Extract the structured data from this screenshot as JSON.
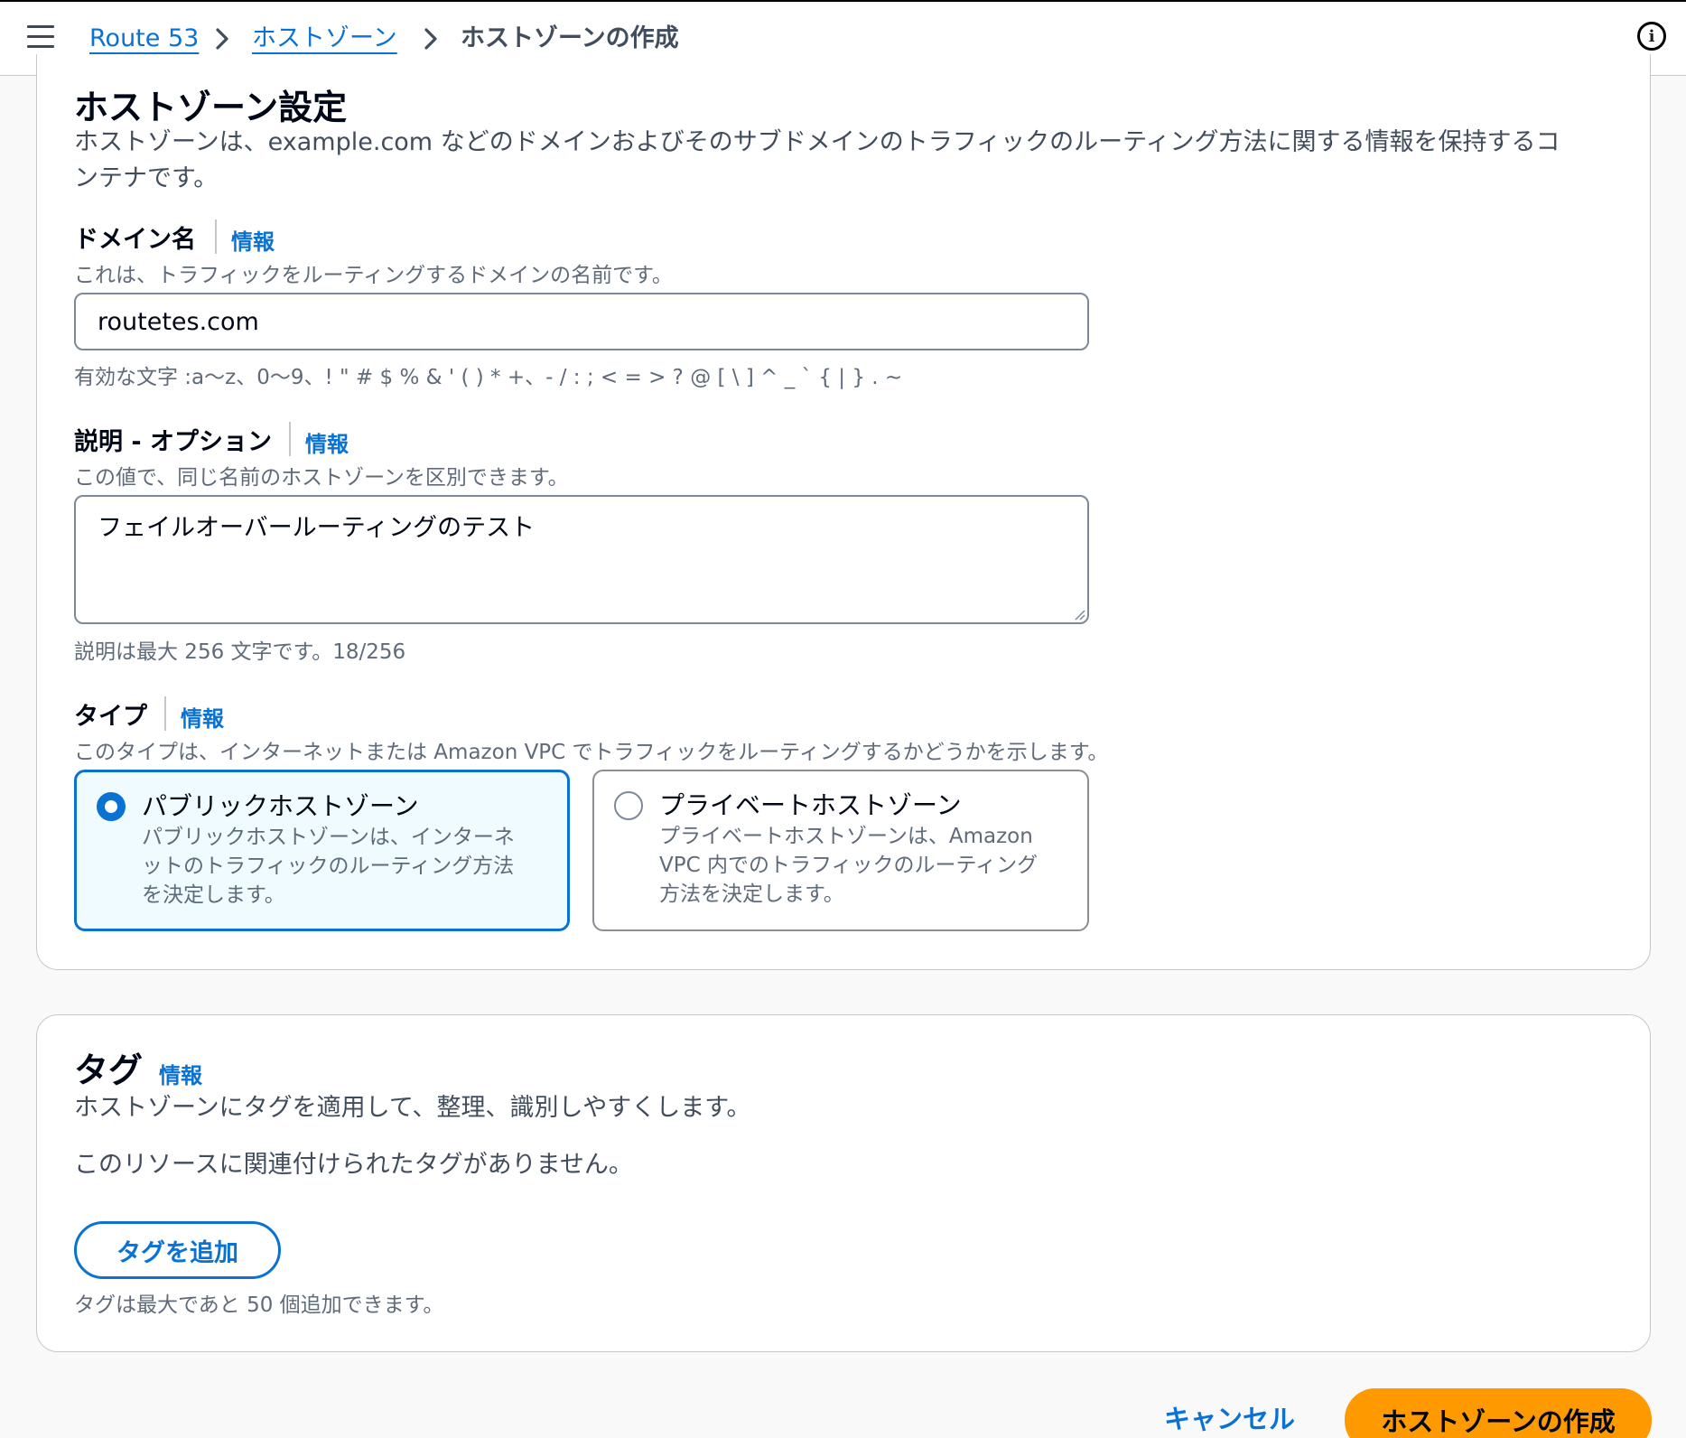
{
  "breadcrumb": {
    "items": [
      {
        "label": "Route 53"
      },
      {
        "label": "ホストゾーン"
      },
      {
        "label": "ホストゾーンの作成"
      }
    ]
  },
  "settings": {
    "title": "ホストゾーン設定",
    "description_line1": "ホストゾーンは、example.com などのドメインおよびそのサブドメインのトラフィックのルーティング方法に関する情報を保持するコ",
    "description_line2": "ンテナです。",
    "domain": {
      "label": "ドメイン名",
      "info": "情報",
      "description": "これは、トラフィックをルーティングするドメインの名前です。",
      "value": "routetes.com",
      "constraint": "有効な文字 :a～z、0～9、! \" # $ % & ' ( ) * +、- / : ; < = > ? @ [ \\ ] ^ _ ` { | } . ~"
    },
    "description_field": {
      "label": "説明 - オプション",
      "info": "情報",
      "description": "この値で、同じ名前のホストゾーンを区別できます。",
      "value": "フェイルオーバールーティングのテスト",
      "constraint": "説明は最大 256 文字です。18/256"
    },
    "type": {
      "label": "タイプ",
      "info": "情報",
      "description": "このタイプは、インターネットまたは Amazon VPC でトラフィックをルーティングするかどうかを示します。",
      "options": [
        {
          "title": "パブリックホストゾーン",
          "desc_lines": [
            "パブリックホストゾーンは、インターネ",
            "ットのトラフィックのルーティング方法",
            "を決定します。"
          ],
          "selected": true
        },
        {
          "title": "プライベートホストゾーン",
          "desc_lines": [
            "プライベートホストゾーンは、Amazon",
            "VPC 内でのトラフィックのルーティング",
            "方法を決定します。"
          ],
          "selected": false
        }
      ]
    }
  },
  "tags": {
    "title": "タグ",
    "info": "情報",
    "description": "ホストゾーンにタグを適用して、整理、識別しやすくします。",
    "empty": "このリソースに関連付けられたタグがありません。",
    "add_button": "タグを追加",
    "limit": "タグは最大であと 50 個追加できます。"
  },
  "footer": {
    "cancel": "キャンセル",
    "create": "ホストゾーンの作成"
  },
  "colors": {
    "link": "#0972d3",
    "primary_button": "#ff9900",
    "selected_card_bg": "#f0fbff"
  },
  "icons": [
    "menu-icon",
    "chevron-right-icon",
    "info-icon"
  ]
}
